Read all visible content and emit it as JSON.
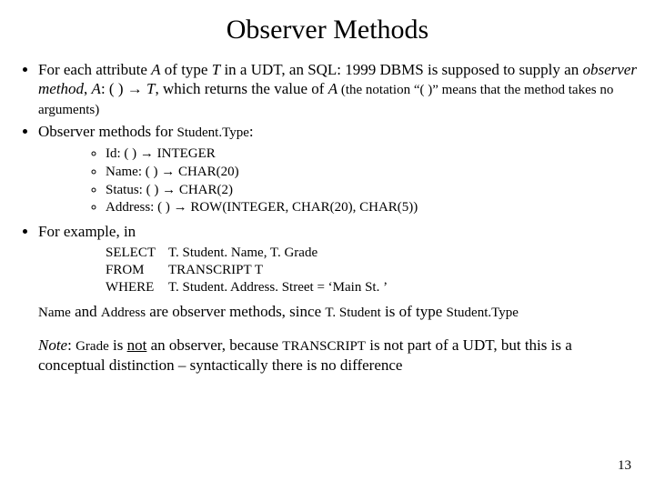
{
  "title": "Observer Methods",
  "b1": {
    "pre1": "For each attribute ",
    "A1": "A",
    "pre2": " of type ",
    "T1": "T",
    "pre3": "  in a UDT, an SQL: 1999 DBMS is supposed to supply an ",
    "obs": "observer method",
    "pre4": ",  ",
    "A2": "A",
    "sig": ": ( ) ",
    "arr": "→",
    "sp": " ",
    "T2": "T",
    "post": ", which returns the value of ",
    "A3": "A",
    "tail": "  (the notation “( )” means that the method takes no arguments)"
  },
  "b2": {
    "pre": "Observer methods for ",
    "st": "Student.Type",
    "post": ":"
  },
  "methods": {
    "m1": "Id: ( ) → INTEGER",
    "m2": "Name: ( ) → CHAR(20)",
    "m3": "Status: ( ) → CHAR(2)",
    "m4": "Address: ( ) → ROW(INTEGER, CHAR(20), CHAR(5))"
  },
  "b3": "For example, in",
  "sql": {
    "kw_select": "SELECT",
    "sel_args": "T. Student. Name,  T. Grade",
    "kw_from": "FROM",
    "from_args": "TRANSCRIPT   T",
    "kw_where": "WHERE",
    "where_args": "T. Student. Address. Street = ‘Main St. ’"
  },
  "p": {
    "name": "Name",
    "mid1": " and ",
    "addr": "Address",
    "mid2": " are observer methods, since ",
    "ts": "T. Student",
    "mid3": " is of type ",
    "st": "Student.Type"
  },
  "note": {
    "lab": "Note",
    "c1": ":  ",
    "grade": "Grade",
    "mid1": "  is ",
    "not": "not",
    "mid2": " an observer, because ",
    "tr": "TRANSCRIPT",
    "tail": " is not part of a UDT, but this is a conceptual distinction – syntactically there is no difference"
  },
  "page": "13"
}
